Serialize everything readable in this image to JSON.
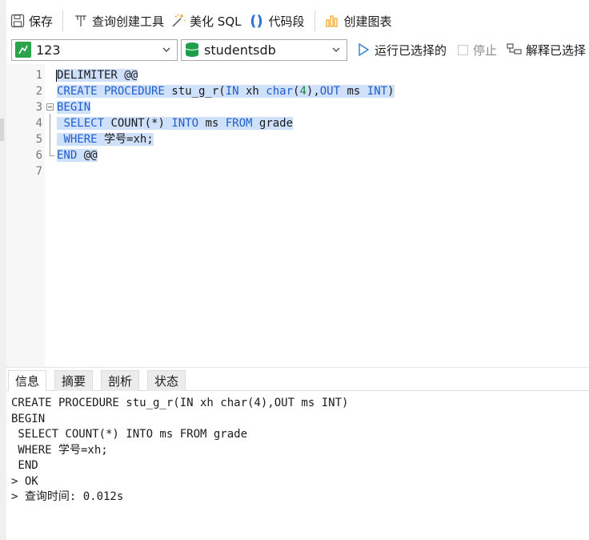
{
  "toolbar": {
    "save": "保存",
    "query_builder": "查询创建工具",
    "beautify_sql": "美化 SQL",
    "code_snippet": "代码段",
    "create_chart": "创建图表"
  },
  "selectors": {
    "connection": "123",
    "database": "studentsdb",
    "run_selected": "运行已选择的",
    "stop": "停止",
    "explain_selected": "解释已选择"
  },
  "editor": {
    "line_numbers": [
      "1",
      "2",
      "3",
      "4",
      "5",
      "6",
      "7"
    ],
    "lines": [
      [
        {
          "t": "DELIMITER @@",
          "c": "plain"
        }
      ],
      [
        {
          "t": "CREATE PROCEDURE",
          "c": "kw"
        },
        {
          "t": " stu_g_r(",
          "c": "plain"
        },
        {
          "t": "IN",
          "c": "kw"
        },
        {
          "t": " xh ",
          "c": "plain"
        },
        {
          "t": "char",
          "c": "kw"
        },
        {
          "t": "(",
          "c": "plain"
        },
        {
          "t": "4",
          "c": "num"
        },
        {
          "t": "),",
          "c": "plain"
        },
        {
          "t": "OUT",
          "c": "kw"
        },
        {
          "t": " ms ",
          "c": "plain"
        },
        {
          "t": "INT",
          "c": "kw"
        },
        {
          "t": ")",
          "c": "plain"
        }
      ],
      [
        {
          "t": "BEGIN",
          "c": "kw"
        }
      ],
      [
        {
          "t": " ",
          "c": "plain"
        },
        {
          "t": "SELECT",
          "c": "kw"
        },
        {
          "t": " COUNT(*) ",
          "c": "plain"
        },
        {
          "t": "INTO",
          "c": "kw"
        },
        {
          "t": " ms ",
          "c": "plain"
        },
        {
          "t": "FROM",
          "c": "kw"
        },
        {
          "t": " grade",
          "c": "plain"
        }
      ],
      [
        {
          "t": " ",
          "c": "plain"
        },
        {
          "t": "WHERE",
          "c": "kw"
        },
        {
          "t": " 学号=xh;",
          "c": "plain"
        }
      ],
      [
        {
          "t": "END",
          "c": "kw"
        },
        {
          "t": " @@",
          "c": "plain"
        }
      ],
      []
    ]
  },
  "result_tabs": [
    "信息",
    "摘要",
    "剖析",
    "状态"
  ],
  "result_lines": [
    "CREATE PROCEDURE stu_g_r(IN xh char(4),OUT ms INT)",
    "BEGIN",
    " SELECT COUNT(*) INTO ms FROM grade",
    " WHERE 学号=xh;",
    " END",
    "> OK",
    "> 查询时间: 0.012s"
  ],
  "colors": {
    "keyword": "#1f5fc9",
    "number": "#1a8a3a",
    "selection": "#cfe0fa",
    "run_icon": "#2a7fd6",
    "db_icon": "#1e9e4a",
    "conn_icon": "#2aa34a"
  },
  "icons": {
    "save": "save-icon",
    "query_builder": "query-builder-icon",
    "beautify": "magic-wand-icon",
    "snippet": "braces-icon",
    "chart": "chart-icon",
    "connection": "connection-icon",
    "database": "database-icon",
    "run": "play-icon",
    "explain": "explain-icon"
  }
}
